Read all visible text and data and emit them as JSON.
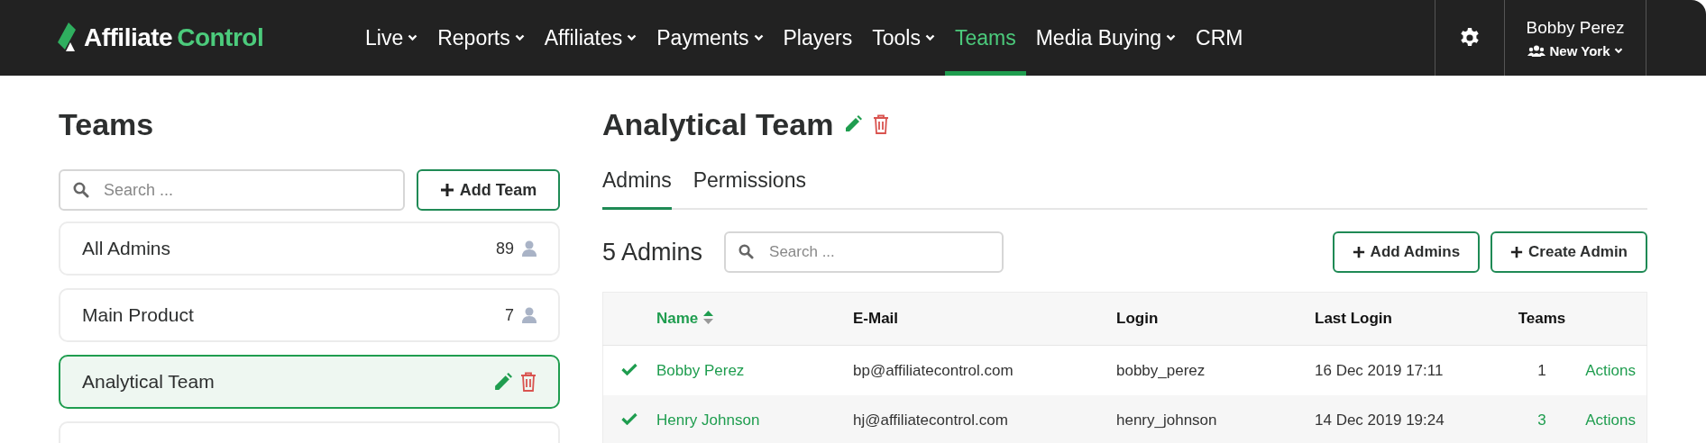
{
  "brand": {
    "first": "Affiliate",
    "second": "Control"
  },
  "nav": [
    {
      "label": "Live",
      "dropdown": true,
      "selected": false
    },
    {
      "label": "Reports",
      "dropdown": true,
      "selected": false
    },
    {
      "label": "Affiliates",
      "dropdown": true,
      "selected": false
    },
    {
      "label": "Payments",
      "dropdown": true,
      "selected": false
    },
    {
      "label": "Players",
      "dropdown": false,
      "selected": false
    },
    {
      "label": "Tools",
      "dropdown": true,
      "selected": false
    },
    {
      "label": "Teams",
      "dropdown": false,
      "selected": true
    },
    {
      "label": "Media Buying",
      "dropdown": true,
      "selected": false
    },
    {
      "label": "CRM",
      "dropdown": false,
      "selected": false
    }
  ],
  "user": {
    "name": "Bobby Perez",
    "team": "New York"
  },
  "sidebar": {
    "title": "Teams",
    "search": {
      "placeholder": "Search ..."
    },
    "add_button": "Add Team",
    "items": [
      {
        "label": "All Admins",
        "count": "89",
        "selected": false
      },
      {
        "label": "Main Product",
        "count": "7",
        "selected": false
      },
      {
        "label": "Analytical Team",
        "selected": true
      }
    ]
  },
  "detail": {
    "title": "Analytical Team",
    "tabs": [
      {
        "label": "Admins",
        "selected": true
      },
      {
        "label": "Permissions",
        "selected": false
      }
    ],
    "count": "5 Admins",
    "search": {
      "placeholder": "Search ..."
    },
    "buttons": [
      "Add Admins",
      "Create Admin"
    ],
    "table": {
      "columns": [
        "Name",
        "E-Mail",
        "Login",
        "Last Login",
        "Teams"
      ],
      "rows": [
        {
          "active": true,
          "name": "Bobby Perez",
          "email": "bp@affiliatecontrol.com",
          "login": "bobby_perez",
          "last_login": "16 Dec 2019 17:11",
          "teams": "1",
          "teams_link": false,
          "action": "Actions"
        },
        {
          "active": true,
          "name": "Henry Johnson",
          "email": "hj@affiliatecontrol.com",
          "login": "henry_johnson",
          "last_login": "14 Dec 2019 19:24",
          "teams": "3",
          "teams_link": true,
          "action": "Actions"
        }
      ]
    }
  }
}
